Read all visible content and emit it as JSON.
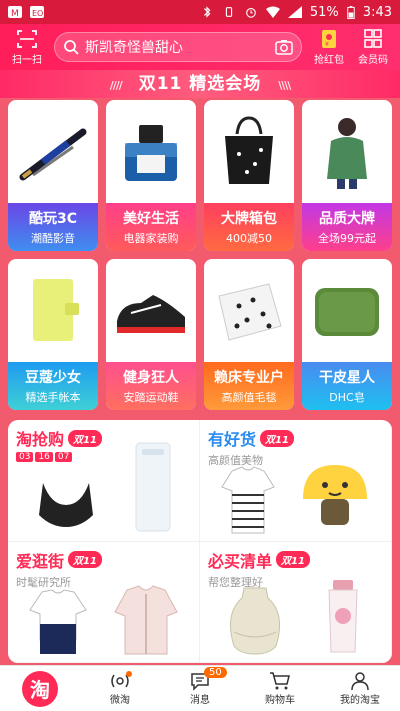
{
  "status_bar": {
    "battery": "51%",
    "time": "3:43"
  },
  "header": {
    "scan_label": "扫一扫",
    "search_text": "斯凯奇怪兽甜心",
    "red_packet_label": "抢红包",
    "member_code_label": "会员码"
  },
  "banner": {
    "title": "双11 精选会场"
  },
  "categories": [
    {
      "title": "酷玩3C",
      "subtitle": "潮酷影音"
    },
    {
      "title": "美好生活",
      "subtitle": "电器家装购"
    },
    {
      "title": "大牌箱包",
      "subtitle": "400减50"
    },
    {
      "title": "品质大牌",
      "subtitle": "全场99元起"
    },
    {
      "title": "豆蔻少女",
      "subtitle": "精选手帐本"
    },
    {
      "title": "健身狂人",
      "subtitle": "安踏运动鞋"
    },
    {
      "title": "赖床专业户",
      "subtitle": "高颜值毛毯"
    },
    {
      "title": "干皮星人",
      "subtitle": "DHC皂"
    }
  ],
  "panels": [
    {
      "title": "淘抢购",
      "badge": "双11",
      "subtitle": "",
      "countdown": [
        "03",
        "16",
        "07"
      ],
      "title_color": "#ff2a55"
    },
    {
      "title": "有好货",
      "badge": "双11",
      "subtitle": "高颜值美物",
      "title_color": "#2a8bf0"
    },
    {
      "title": "爱逛街",
      "badge": "双11",
      "subtitle": "时髦研究所",
      "title_color": "#ff2a55"
    },
    {
      "title": "必买清单",
      "badge": "双11",
      "subtitle": "帮您整理好",
      "title_color": "#ff2a55"
    }
  ],
  "tabbar": {
    "home_logo": "淘",
    "weitao": "微淘",
    "messages": "消息",
    "messages_count": "50",
    "cart": "购物车",
    "my_taobao": "我的淘宝"
  }
}
